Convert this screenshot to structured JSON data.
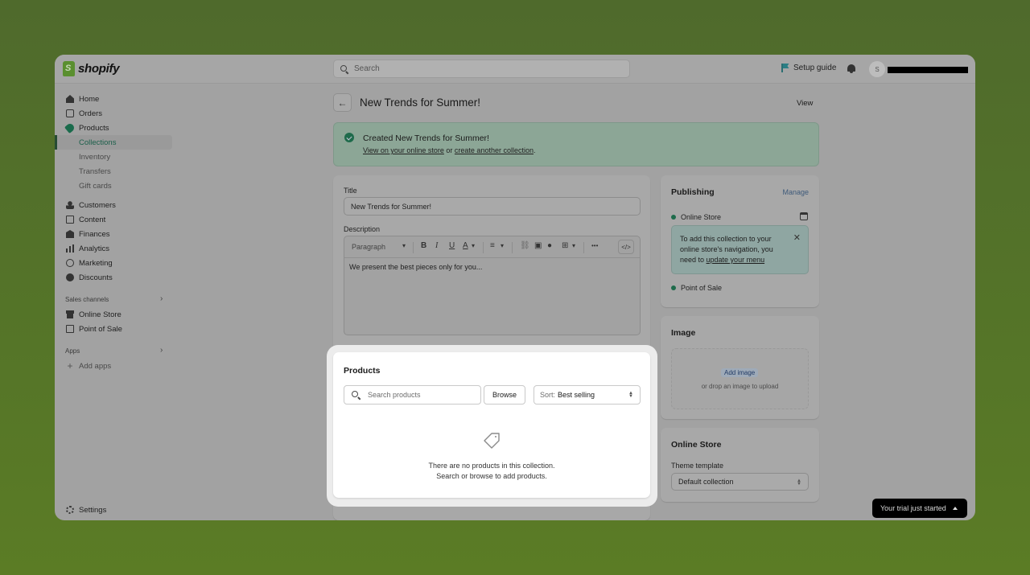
{
  "app": {
    "brand": "shopify"
  },
  "topbar": {
    "search_placeholder": "Search",
    "setup_guide": "Setup guide",
    "avatar_initial": "S"
  },
  "sidebar": {
    "items": [
      {
        "label": "Home",
        "icon": "home-icon"
      },
      {
        "label": "Orders",
        "icon": "orders-icon"
      },
      {
        "label": "Products",
        "icon": "tag-icon"
      },
      {
        "label": "Collections",
        "active": true
      },
      {
        "label": "Inventory"
      },
      {
        "label": "Transfers"
      },
      {
        "label": "Gift cards"
      },
      {
        "label": "Customers",
        "icon": "person-icon"
      },
      {
        "label": "Content",
        "icon": "content-icon"
      },
      {
        "label": "Finances",
        "icon": "bank-icon"
      },
      {
        "label": "Analytics",
        "icon": "bar-chart-icon"
      },
      {
        "label": "Marketing",
        "icon": "target-icon"
      },
      {
        "label": "Discounts",
        "icon": "discount-icon"
      }
    ],
    "sales_channels_label": "Sales channels",
    "sales_channels": [
      {
        "label": "Online Store",
        "icon": "store-icon"
      },
      {
        "label": "Point of Sale",
        "icon": "pos-icon"
      }
    ],
    "apps_label": "Apps",
    "add_apps": "Add apps",
    "settings": "Settings"
  },
  "header": {
    "back_icon": "arrow-left-icon",
    "title": "New Trends for Summer!",
    "view": "View"
  },
  "banner": {
    "title": "Created New Trends for Summer!",
    "link1": "View on your online store",
    "connector": " or ",
    "link2": "create another collection",
    "end": "."
  },
  "form": {
    "title_label": "Title",
    "title_value": "New Trends for Summer!",
    "description_label": "Description",
    "toolbar": {
      "paragraph": "Paragraph",
      "bold": "B",
      "italic": "I",
      "underline": "U",
      "color": "A",
      "more": "•••",
      "code": "</>"
    },
    "description_value": "We present the best pieces only for you..."
  },
  "products": {
    "title": "Products",
    "search_placeholder": "Search products",
    "browse": "Browse",
    "sort_prefix": "Sort:",
    "sort_value": "Best selling",
    "empty_line1": "There are no products in this collection.",
    "empty_line2": "Search or browse to add products."
  },
  "publishing": {
    "title": "Publishing",
    "manage": "Manage",
    "channels": [
      "Online Store",
      "Point of Sale"
    ],
    "info_text": "To add this collection to your online store's navigation, you need to ",
    "info_link": "update your menu"
  },
  "image": {
    "title": "Image",
    "add": "Add image",
    "drop": "or drop an image to upload"
  },
  "online_store": {
    "title": "Online Store",
    "template_label": "Theme template",
    "template_value": "Default collection"
  },
  "trial": {
    "label": "Your trial just started"
  },
  "colors": {
    "brand_green": "#5a8f2f",
    "active_green": "#1b5f4a",
    "success": "#1e6b4b",
    "link_blue": "#3e5a7a"
  }
}
